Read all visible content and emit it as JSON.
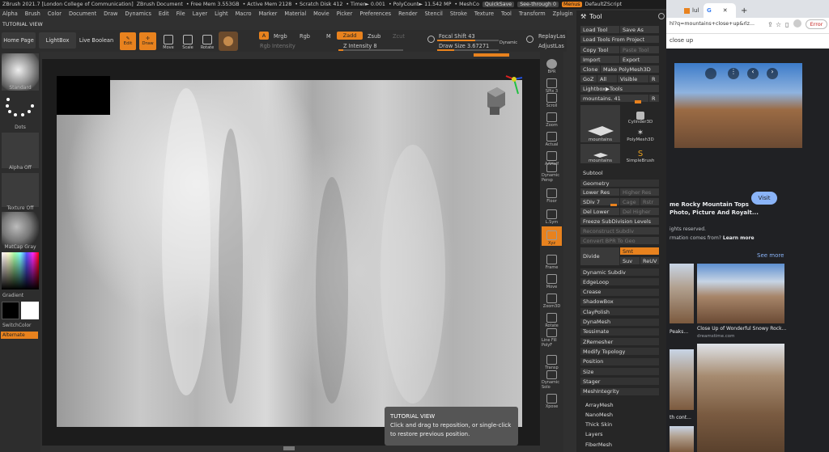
{
  "titlebar": {
    "app": "ZBrush 2021.7 [London College of Communication]",
    "doc": "ZBrush Document",
    "free_mem": "• Free Mem 3.553GB",
    "active_mem": "• Active Mem 2128",
    "scratch": "• Scratch Disk 412",
    "timer": "• Timer► 0.001",
    "polycount": "• PolyCount► 11.542 MP",
    "meshcount": "• MeshCo",
    "quicksave": "QuickSave",
    "seethrough": "See-through  0",
    "menus": "Menus",
    "script": "DefaultZScript"
  },
  "menubar": [
    "Alpha",
    "Brush",
    "Color",
    "Document",
    "Draw",
    "Dynamics",
    "Edit",
    "File",
    "Layer",
    "Light",
    "Macro",
    "Marker",
    "Material",
    "Movie",
    "Picker",
    "Preferences",
    "Render",
    "Stencil",
    "Stroke",
    "Texture",
    "Tool",
    "Transform",
    "Zplugin",
    "Zscript",
    "Help"
  ],
  "tutorial_label": "TUTORIAL VIEW",
  "shelf": {
    "home": "Home Page",
    "lightbox": "LightBox",
    "liveboolean": "Live Boolean",
    "edit": "Edit",
    "draw": "Draw",
    "move": "Move",
    "scale": "Scale",
    "rotate": "Rotate",
    "a": "A",
    "mrgb": "Mrgb",
    "rgb": "Rgb",
    "m": "M",
    "zadd": "Zadd",
    "zsub": "Zsub",
    "zcut": "Zcut",
    "rgb_intensity": "Rgb Intensity",
    "z_intensity": "Z Intensity 8",
    "focal": "Focal Shift 43",
    "drawsize": "Draw Size 3.67271",
    "dynamic": "Dynamic",
    "replay": "ReplayLas",
    "adjust": "AdjustLas",
    "focal_fill": 0.62,
    "drawsize_fill": 0.28
  },
  "left": {
    "standard": "Standard",
    "dots": "Dots",
    "alpha_off": "Alpha Off",
    "texture_off": "Texture Off",
    "matcap": "MatCap Gray",
    "gradient": "Gradient",
    "switchcolor": "SwitchColor",
    "alternate": "Alternate"
  },
  "rightstrip": [
    "BPR",
    "SPix 3",
    "Scroll",
    "Zoom",
    "Actual",
    "AAHalf",
    "Dynamic Persp",
    "Floor",
    "L.Sym",
    "Xyz",
    "Frame",
    "Move",
    "Zoom3D",
    "Rotate",
    "Line Fill PolyF",
    "Transp",
    "Dynamic Solo",
    "Xpose"
  ],
  "rightstrip_spix": "SPix 3",
  "tooltip": {
    "title": "TUTORIAL VIEW",
    "line1": "Click and drag to reposition, or single-click",
    "line2": "to restore previous position."
  },
  "toolpanel": {
    "title": "Tool",
    "load_tool": "Load Tool",
    "save_as": "Save As",
    "load_from_project": "Load Tools From Project",
    "copy_tool": "Copy Tool",
    "paste_tool": "Paste Tool",
    "import": "Import",
    "export": "Export",
    "clone": "Clone",
    "make_polymesh": "Make PolyMesh3D",
    "goz": "GoZ",
    "all": "All",
    "visible": "Visible",
    "r": "R",
    "lightbox_tools": "Lightbox▶Tools",
    "mountains": "mountains. 41",
    "r2": "R",
    "thumbs": [
      "mountains",
      "Cylinder3D",
      "mountains",
      "PolyMesh3D",
      "mountains",
      "SimpleBrush"
    ],
    "subtool": "Subtool",
    "geometry": "Geometry",
    "lower_res": "Lower Res",
    "higher_res": "Higher Res",
    "sdiv": "SDiv 7",
    "cage": "Cage",
    "rstr": "Rstr",
    "del_lower": "Del Lower",
    "del_higher": "Del Higher",
    "freeze": "Freeze SubDivision Levels",
    "reconstruct": "Reconstruct Subdiv",
    "convert_bpr": "Convert BPR To Geo",
    "divide": "Divide",
    "smt": "Smt",
    "suv": "Suv",
    "reuv": "ReUV",
    "items": [
      "Dynamic Subdiv",
      "EdgeLoop",
      "Crease",
      "ShadowBox",
      "ClayPolish",
      "DynaMesh",
      "Tessimate",
      "ZRemesher",
      "Modify Topology",
      "Position",
      "Size",
      "Stager",
      "MeshIntegrity"
    ],
    "items2": [
      "ArrayMesh",
      "NanoMesh",
      "Thick Skin",
      "Layers",
      "FiberMesh"
    ]
  },
  "browser": {
    "tab1": "lul",
    "tab2": "G",
    "newtab": "+",
    "url": "hl?q=mountains+close+up&rlz...",
    "error": "Error",
    "query": "close up",
    "title_line1": "me Rocky Mountain Tops",
    "title_line2": "Photo, Picture And Royalt...",
    "visit": "Visit",
    "rights": "ights reserved.",
    "info_prefix": "rmation comes from?",
    "learn_more": "Learn more",
    "see_more": "See more",
    "cap1": "Peaks...",
    "cap2": "Close Up of Wonderful Snowy Rock...",
    "cap2_src": "dreamstime.com",
    "cap3": "th cont..."
  }
}
